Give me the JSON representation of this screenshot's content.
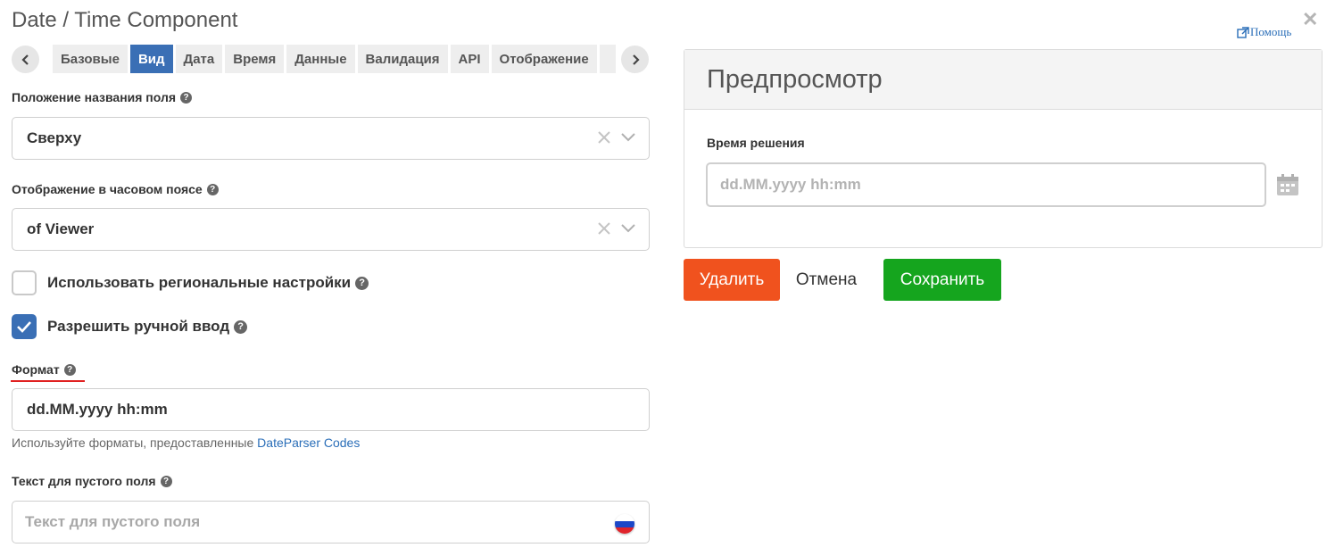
{
  "dialog": {
    "title": "Date / Time Component",
    "help_label": "Помощь"
  },
  "tabs": [
    {
      "label": "Базовые",
      "active": false
    },
    {
      "label": "Вид",
      "active": true
    },
    {
      "label": "Дата",
      "active": false
    },
    {
      "label": "Время",
      "active": false
    },
    {
      "label": "Данные",
      "active": false
    },
    {
      "label": "Валидация",
      "active": false
    },
    {
      "label": "API",
      "active": false
    },
    {
      "label": "Отображение",
      "active": false
    }
  ],
  "form": {
    "label_position": {
      "label": "Положение названия поля",
      "value": "Сверху"
    },
    "timezone_display": {
      "label": "Отображение в часовом поясе",
      "value": "of Viewer"
    },
    "use_locale": {
      "label": "Использовать региональные настройки",
      "checked": false
    },
    "allow_manual_input": {
      "label": "Разрешить ручной ввод",
      "checked": true
    },
    "format": {
      "label": "Формат",
      "value": "dd.MM.yyyy hh:mm",
      "hint_text": "Используйте форматы, предоставленные ",
      "hint_link": "DateParser Codes"
    },
    "placeholder_field": {
      "label": "Текст для пустого поля",
      "placeholder": "Текст для пустого поля"
    }
  },
  "preview": {
    "title": "Предпросмотр",
    "field_label": "Время решения",
    "field_placeholder": "dd.MM.yyyy hh:mm"
  },
  "actions": {
    "delete_label": "Удалить",
    "cancel_label": "Отмена",
    "save_label": "Сохранить"
  },
  "colors": {
    "active_tab": "#3a6fb5",
    "delete": "#f0521e",
    "save": "#15a51e",
    "link": "#2a6eb8",
    "format_underline": "#e02020"
  }
}
